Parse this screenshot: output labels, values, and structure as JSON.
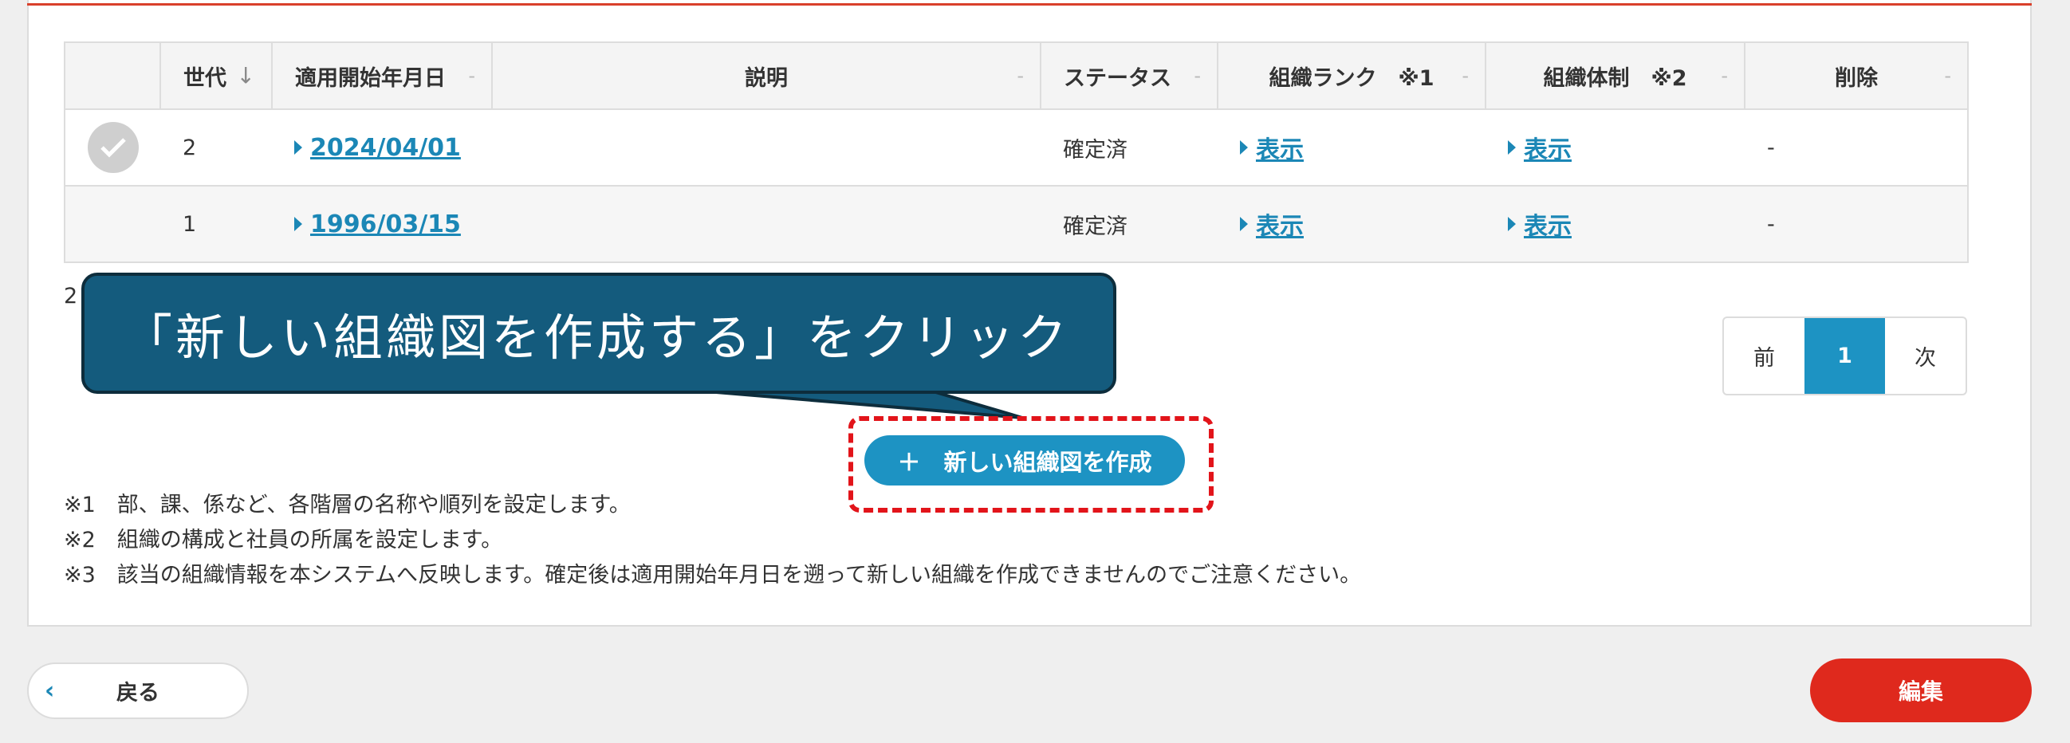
{
  "table": {
    "headers": [
      {
        "label": ""
      },
      {
        "label": "世代",
        "sort": "↓"
      },
      {
        "label": "適用開始年月日",
        "sort": "-"
      },
      {
        "label": "説明",
        "sort": "-"
      },
      {
        "label": "ステータス",
        "sort": "-"
      },
      {
        "label": "組織ランク　※1",
        "sort": "-"
      },
      {
        "label": "組織体制　※2",
        "sort": "-"
      },
      {
        "label": "削除",
        "sort": "-"
      }
    ],
    "rows": [
      {
        "generation": "2",
        "start_date": "2024/04/01",
        "description": "",
        "status": "確定済",
        "rank_link": "表示",
        "structure_link": "表示",
        "delete": "-"
      },
      {
        "generation": "1",
        "start_date": "1996/03/15",
        "description": "",
        "status": "確定済",
        "rank_link": "表示",
        "structure_link": "表示",
        "delete": "-"
      }
    ]
  },
  "count_text": "2",
  "pagination": {
    "prev": "前",
    "current": "1",
    "next": "次"
  },
  "callout_text": "「新しい組織図を作成する」をクリック",
  "new_button_label": "＋　新しい組織図を作成",
  "notes": [
    "※1　部、課、係など、各階層の名称や順列を設定します。",
    "※2　組織の構成と社員の所属を設定します。",
    "※3　該当の組織情報を本システムへ反映します。確定後は適用開始年月日を遡って新しい組織を作成できませんのでご注意ください。"
  ],
  "back_label": "戻る",
  "edit_label": "編集",
  "colors": {
    "accent": "#1d93c3",
    "danger": "#df291d",
    "callout": "#145b7d"
  }
}
